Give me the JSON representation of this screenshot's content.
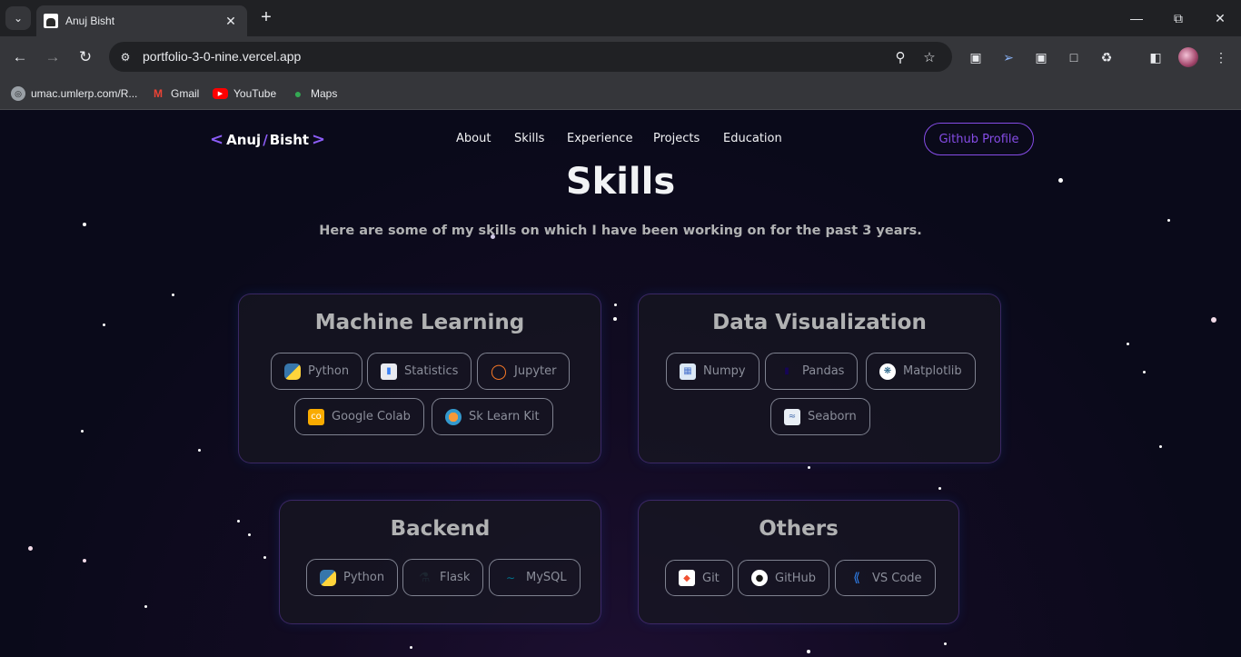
{
  "browser": {
    "tab_title": "Anuj Bisht",
    "url": "portfolio-3-0-nine.vercel.app",
    "bookmarks": [
      {
        "label": "umac.umlerp.com/R...",
        "icon": "globe-icon"
      },
      {
        "label": "Gmail",
        "icon": "gmail-icon"
      },
      {
        "label": "YouTube",
        "icon": "youtube-icon"
      },
      {
        "label": "Maps",
        "icon": "maps-icon"
      }
    ]
  },
  "site": {
    "logo": {
      "first": "Anuj",
      "sep": "/",
      "last": "Bisht",
      "open": "<",
      "close": ">"
    },
    "nav": [
      "About",
      "Skills",
      "Experience",
      "Projects",
      "Education"
    ],
    "github_button": "Github Profile",
    "accent_color": "#854ce6"
  },
  "skills": {
    "title": "Skills",
    "description": "Here are some of my skills on which I have been working on for the past 3 years.",
    "groups": [
      {
        "title": "Machine Learning",
        "items": [
          "Python",
          "Statistics",
          "Jupyter",
          "Google Colab",
          "Sk Learn Kit"
        ]
      },
      {
        "title": "Data Visualization",
        "items": [
          "Numpy",
          "Pandas",
          "Matplotlib",
          "Seaborn"
        ]
      },
      {
        "title": "Backend",
        "items": [
          "Python",
          "Flask",
          "MySQL"
        ]
      },
      {
        "title": "Others",
        "items": [
          "Git",
          "GitHub",
          "VS Code"
        ]
      }
    ]
  }
}
